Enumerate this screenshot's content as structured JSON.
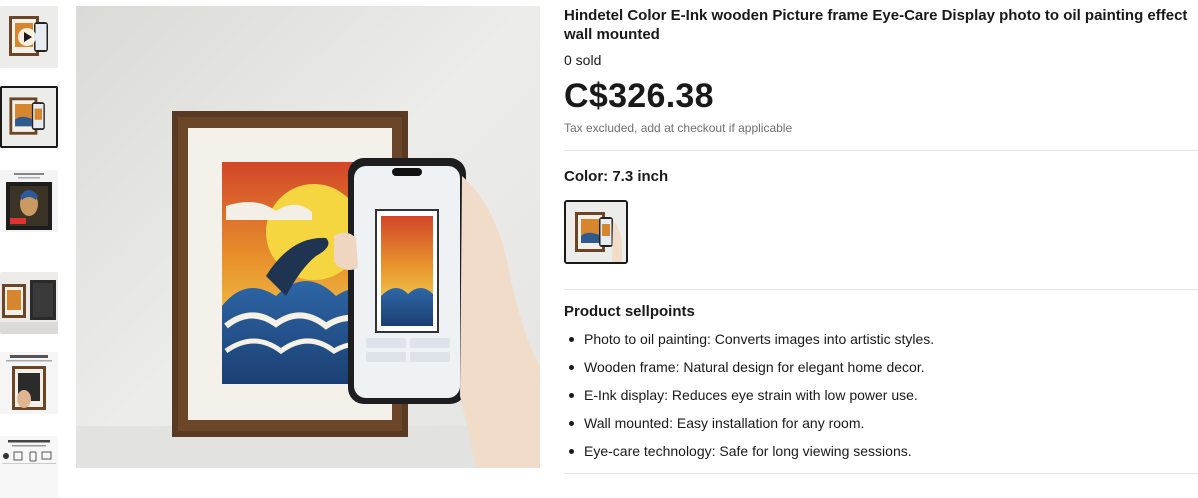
{
  "product": {
    "title": "Hindetel Color E-Ink wooden Picture frame Eye-Care Display photo to oil painting effect wall mounted",
    "sold": "0 sold",
    "price": "C$326.38",
    "tax_note": "Tax excluded, add at checkout if applicable"
  },
  "variant": {
    "label": "Color: 7.3 inch"
  },
  "sellpoints": {
    "title": "Product sellpoints",
    "items": [
      "Photo to oil painting: Converts images into artistic styles.",
      "Wooden frame: Natural design for elegant home decor.",
      "E-Ink display: Reduces eye strain with low power use.",
      "Wall mounted: Easy installation for any room.",
      "Eye-care technology: Safe for long viewing sessions."
    ]
  },
  "gallery": {
    "thumbnails": [
      "video-thumbnail",
      "frame-phone-thumbnail",
      "pearl-earring-thumbnail",
      "frames-side-thumbnail",
      "frame-usage-thumbnail",
      "features-thumbnail"
    ],
    "selected_index": 1
  },
  "colors": {
    "frame_wood": "#5a3a22",
    "text": "#191919",
    "muted": "#707070"
  }
}
